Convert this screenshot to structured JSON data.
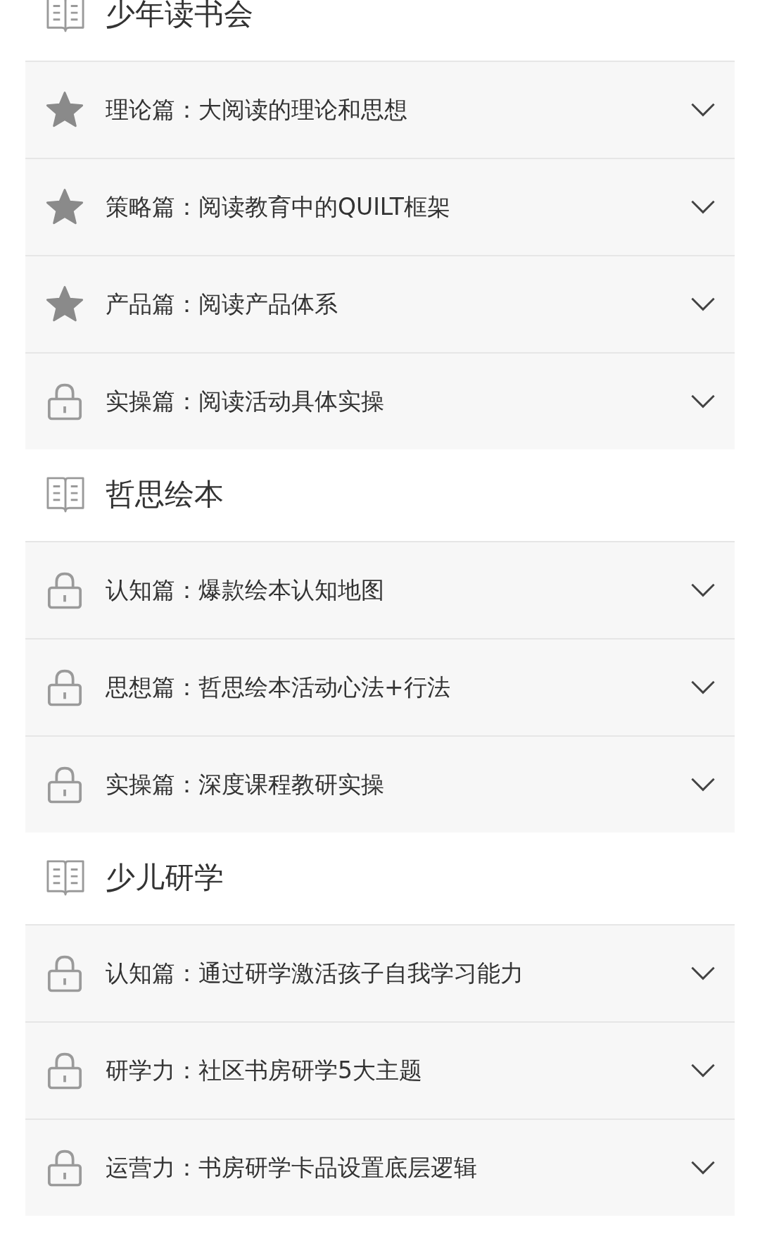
{
  "sections": [
    {
      "title": "少年读书会",
      "items": [
        {
          "kind": "star",
          "label": "理论篇：大阅读的理论和思想"
        },
        {
          "kind": "star",
          "label": "策略篇：阅读教育中的QUILT框架"
        },
        {
          "kind": "star",
          "label": "产品篇：阅读产品体系"
        },
        {
          "kind": "lock",
          "label": "实操篇：阅读活动具体实操"
        }
      ]
    },
    {
      "title": "哲思绘本",
      "items": [
        {
          "kind": "lock",
          "label": "认知篇：爆款绘本认知地图"
        },
        {
          "kind": "lock",
          "label": "思想篇：哲思绘本活动心法+行法"
        },
        {
          "kind": "lock",
          "label": "实操篇：深度课程教研实操"
        }
      ]
    },
    {
      "title": "少儿研学",
      "items": [
        {
          "kind": "lock",
          "label": "认知篇：通过研学激活孩子自我学习能力"
        },
        {
          "kind": "lock",
          "label": "研学力：社区书房研学5大主题"
        },
        {
          "kind": "lock",
          "label": "运营力：书房研学卡品设置底层逻辑"
        }
      ]
    }
  ]
}
